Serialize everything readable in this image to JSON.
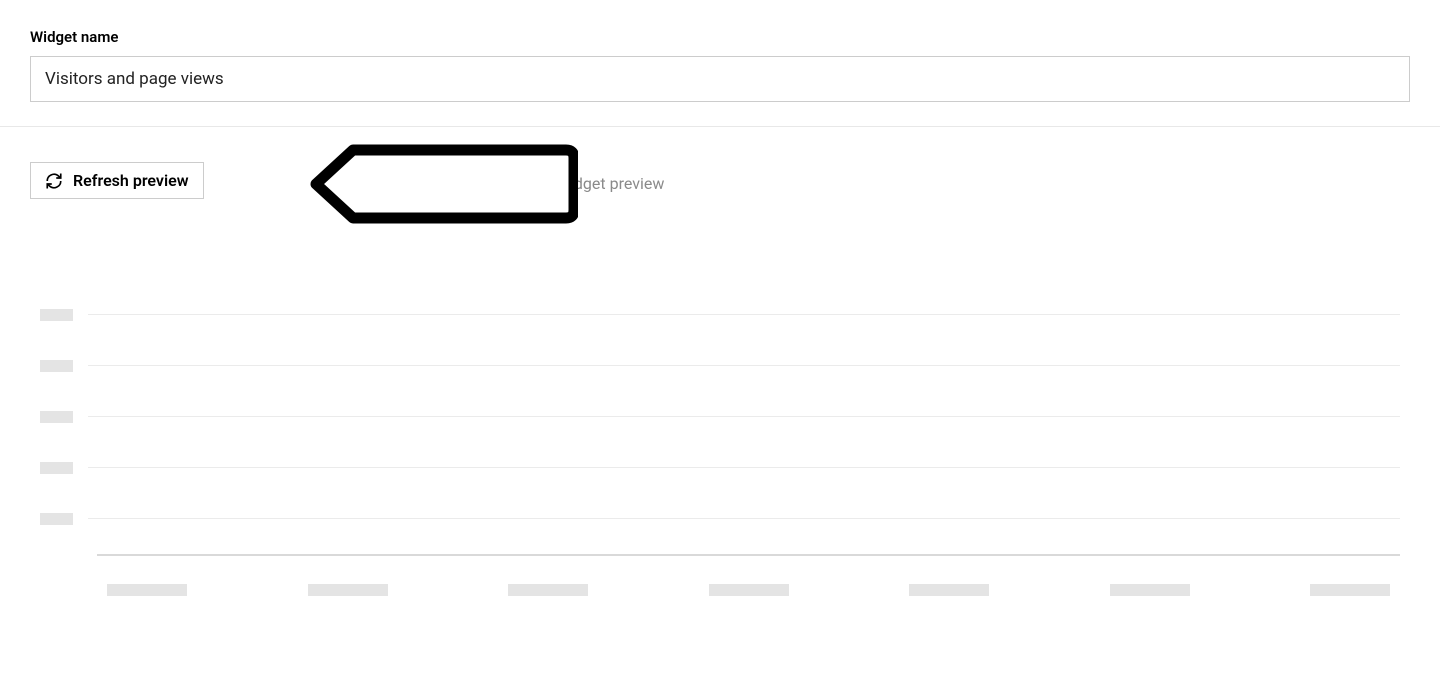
{
  "form": {
    "widget_name_label": "Widget name",
    "widget_name_value": "Visitors and page views"
  },
  "preview": {
    "refresh_button_label": "Refresh preview",
    "hint_text_suffix": "idget preview"
  },
  "chart_data": {
    "type": "line",
    "state": "skeleton",
    "y_ticks_count": 5,
    "x_ticks_count": 7,
    "title": "",
    "xlabel": "",
    "ylabel": "",
    "series": []
  }
}
